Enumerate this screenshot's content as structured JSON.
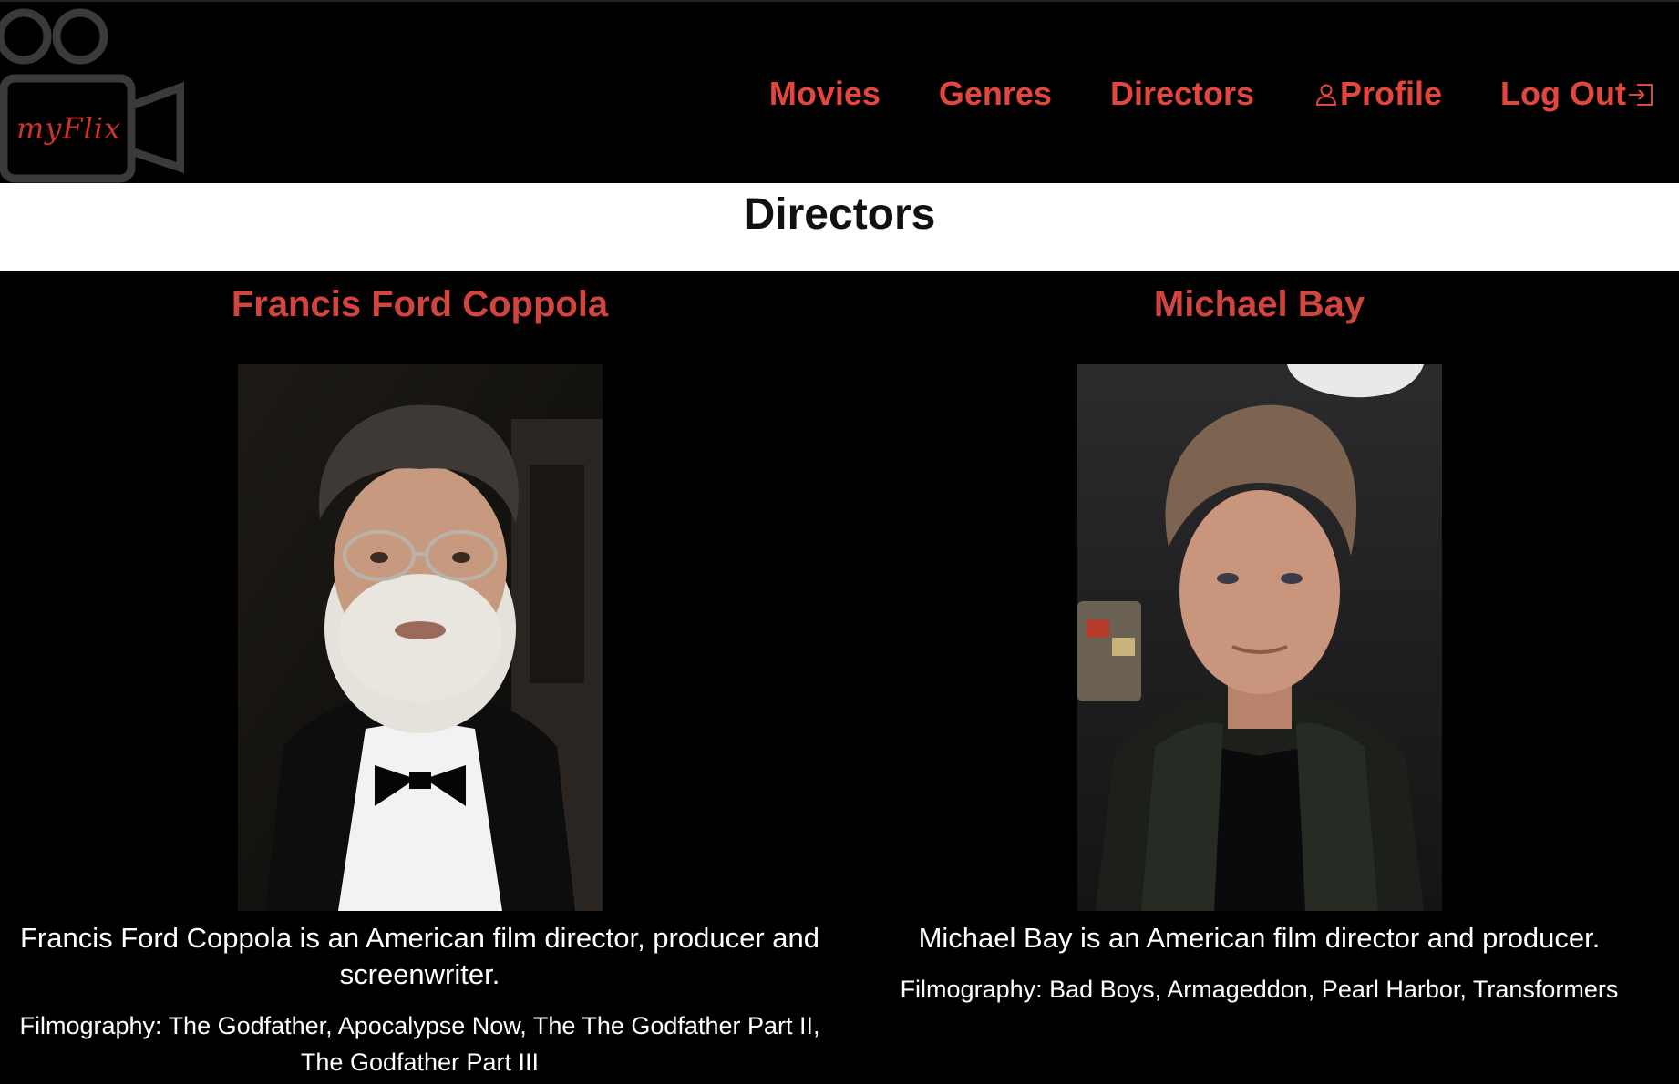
{
  "brand": {
    "logo_text": "myFlix"
  },
  "nav": {
    "items": [
      {
        "label": "Movies",
        "icon": ""
      },
      {
        "label": "Genres",
        "icon": ""
      },
      {
        "label": "Directors",
        "icon": ""
      },
      {
        "label": "Profile",
        "icon": "person-icon"
      },
      {
        "label": "Log Out",
        "icon": "logout-icon"
      }
    ],
    "color": "#e2463c"
  },
  "page": {
    "title": "Directors"
  },
  "directors": [
    {
      "name": "Francis Ford Coppola",
      "description": "Francis Ford Coppola is an American film director, producer and screenwriter.",
      "filmography": "Filmography: The Godfather, Apocalypse Now, The The Godfather Part II, The Godfather Part III"
    },
    {
      "name": "Michael Bay",
      "description": "Michael Bay is an American film director and producer.",
      "filmography": "Filmography: Bad Boys, Armageddon, Pearl Harbor, Transformers"
    }
  ],
  "colors": {
    "accent": "#e2463c",
    "name_color": "#d2453f",
    "background": "#000000",
    "title_bar": "#ffffff"
  }
}
